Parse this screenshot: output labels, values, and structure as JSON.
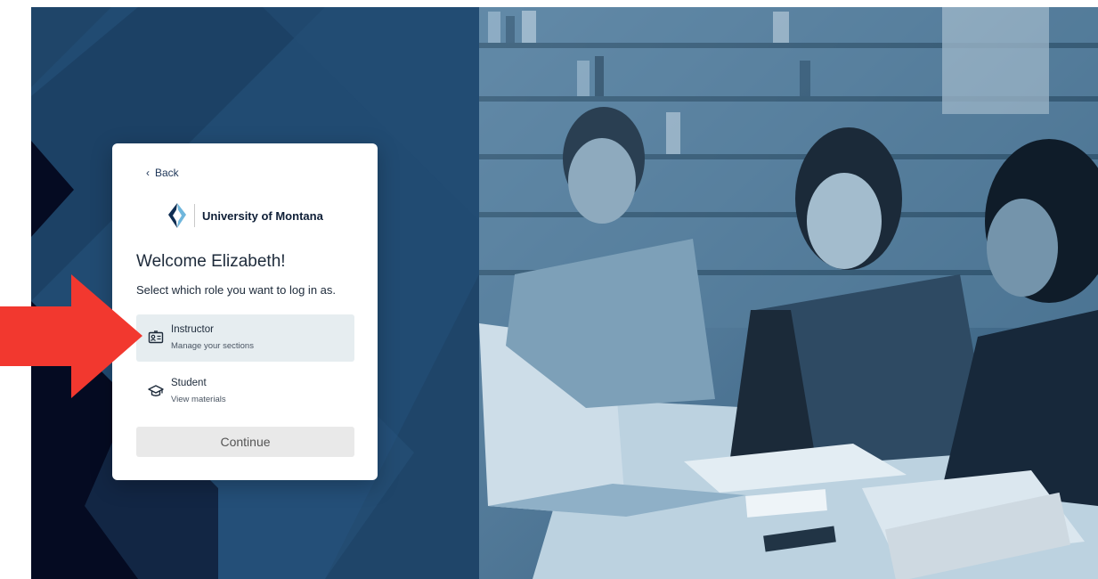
{
  "colors": {
    "left_panel_bg": "#1f4569",
    "card_bg": "#ffffff",
    "selected_role_bg": "#e6edf0",
    "continue_bg": "#e9e9e9",
    "annotation_arrow": "#f2382f",
    "photo_tint": "#3f6e91"
  },
  "login": {
    "back_label": "Back",
    "university_name": "University of Montana",
    "welcome_text": "Welcome Elizabeth!",
    "role_prompt": "Select which role you want to log in as.",
    "roles": [
      {
        "title": "Instructor",
        "description": "Manage your sections",
        "icon": "id-card-icon",
        "selected": true
      },
      {
        "title": "Student",
        "description": "View materials",
        "icon": "graduation-cap-icon",
        "selected": false
      }
    ],
    "continue_label": "Continue"
  },
  "icons": {
    "back": "chevron-left-icon",
    "logo": "university-logo-icon"
  }
}
